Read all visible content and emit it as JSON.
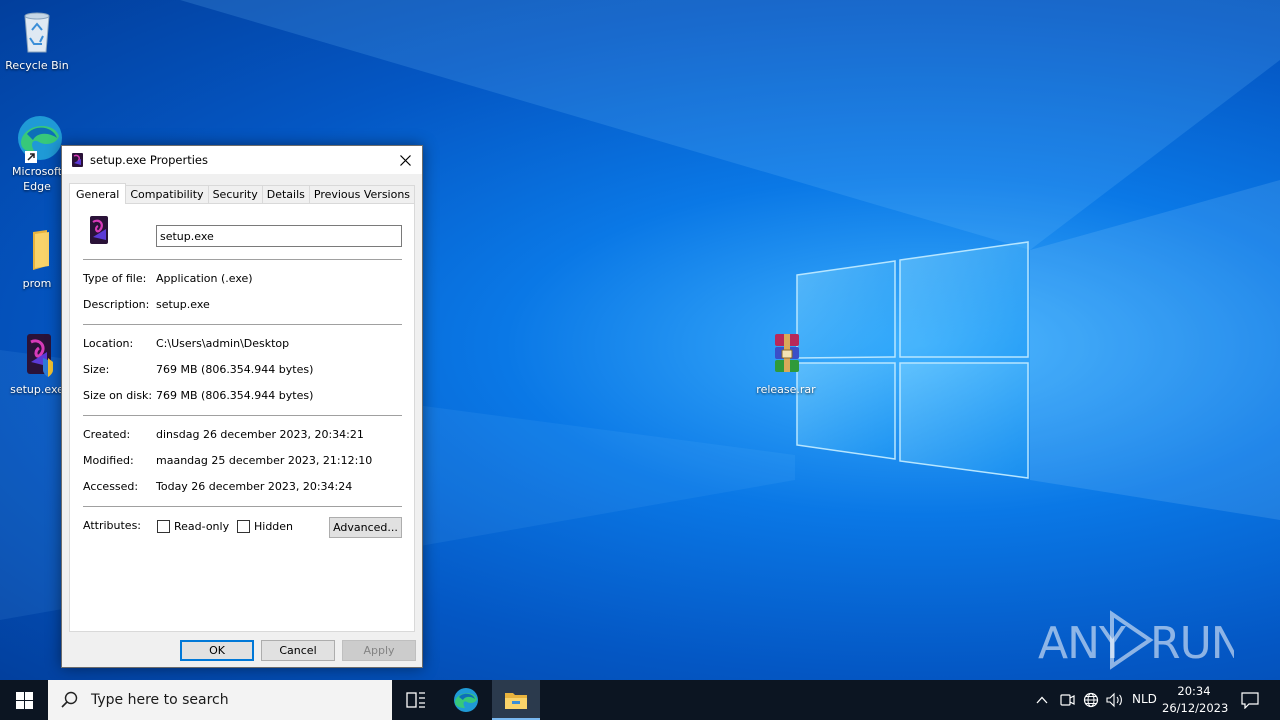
{
  "desktop": {
    "icons": [
      {
        "label": "Recycle Bin",
        "icon": "recycle-bin-icon"
      },
      {
        "label": "Microsoft Edge",
        "icon": "edge-icon"
      },
      {
        "label": "prom",
        "icon": "folder-icon"
      },
      {
        "label": "setup.exe",
        "icon": "setup-exe-icon"
      },
      {
        "label": "release.rar",
        "icon": "winrar-archive-icon"
      }
    ]
  },
  "dialog": {
    "title": "setup.exe Properties",
    "tabs": [
      "General",
      "Compatibility",
      "Security",
      "Details",
      "Previous Versions"
    ],
    "active_tab": "General",
    "file_name": "setup.exe",
    "type_label": "Type of file:",
    "type_value": "Application (.exe)",
    "description_label": "Description:",
    "description_value": "setup.exe",
    "location_label": "Location:",
    "location_value": "C:\\Users\\admin\\Desktop",
    "size_label": "Size:",
    "size_value": "769 MB (806.354.944 bytes)",
    "size_on_disk_label": "Size on disk:",
    "size_on_disk_value": "769 MB (806.354.944 bytes)",
    "created_label": "Created:",
    "created_value": "dinsdag 26 december 2023, 20:34:21",
    "modified_label": "Modified:",
    "modified_value": "maandag 25 december 2023, 21:12:10",
    "accessed_label": "Accessed:",
    "accessed_value": "Today 26 december 2023, 20:34:24",
    "attributes_label": "Attributes:",
    "readonly_label": "Read-only",
    "readonly_checked": false,
    "hidden_label": "Hidden",
    "hidden_checked": false,
    "advanced_button": "Advanced...",
    "ok_button": "OK",
    "cancel_button": "Cancel",
    "apply_button": "Apply"
  },
  "taskbar": {
    "search_placeholder": "Type here to search",
    "language": "NLD",
    "time": "20:34",
    "date": "26/12/2023"
  },
  "watermark": {
    "left": "ANY",
    "right": "RUN"
  },
  "colors": {
    "accent": "#0078d7",
    "taskbar": "#0c1522",
    "wallpaper": "#0a78e6"
  }
}
